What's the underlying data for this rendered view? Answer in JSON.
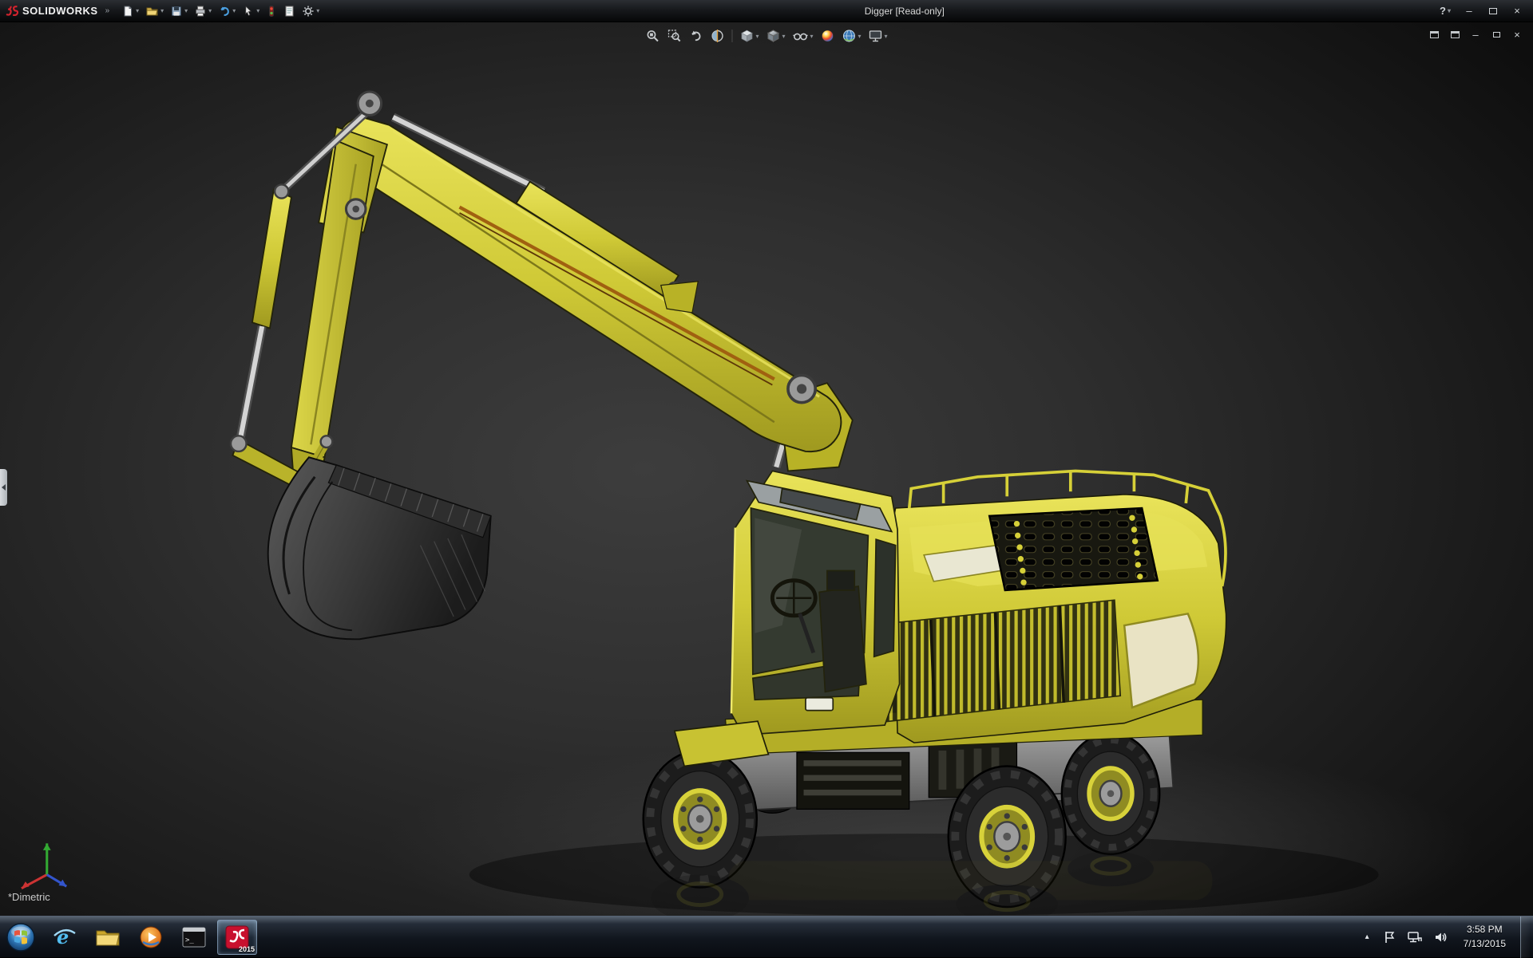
{
  "app": {
    "brand": "SOLIDWORKS",
    "title": "Digger [Read-only]",
    "view_label": "*Dimetric"
  },
  "glyphs": {
    "brand_chevron": "»",
    "dropdown": "▾",
    "help": "?",
    "minimize": "–",
    "close": "×",
    "tray_chevron": "▴"
  },
  "quick_access_toolbar": {
    "items": [
      "new",
      "open",
      "save",
      "print",
      "undo",
      "select",
      "rebuild",
      "file-properties",
      "options"
    ]
  },
  "heads_up_toolbar": {
    "items": [
      "zoom-to-fit",
      "zoom-to-area",
      "previous-view",
      "section-view",
      "view-orientation",
      "display-style",
      "hide-show-items",
      "edit-appearance",
      "apply-scene",
      "view-settings"
    ]
  },
  "document_window_controls": {
    "items": [
      "tile-window",
      "cascade-window",
      "minimize-document",
      "restore-document",
      "close-document"
    ]
  },
  "model": {
    "name": "excavator-3d-model",
    "primary_color": "#cfc936",
    "view": "*Dimetric"
  },
  "taskbar": {
    "buttons": [
      "start",
      "internet-explorer",
      "windows-explorer",
      "media-player",
      "command-prompt",
      "solidworks-2015"
    ],
    "active_button": "solidworks-2015",
    "solidworks_badge": "2015",
    "tray": {
      "time": "3:58 PM",
      "date": "7/13/2015",
      "icons": [
        "hidden-icons-chevron",
        "action-center",
        "network",
        "volume"
      ]
    }
  },
  "icons": {
    "logo-mark": "red 3S solidworks mark",
    "new": "blank document",
    "open": "folder",
    "save": "floppy disk",
    "print": "printer",
    "undo": "curved blue arrow",
    "select": "cursor arrow",
    "rebuild": "traffic light",
    "file-properties": "sheet with lines",
    "options": "gear",
    "zoom-to-fit": "magnifier over box",
    "zoom-to-area": "magnifier with rectangle",
    "previous-view": "back curved arrow",
    "section-view": "sphere cut by plane",
    "view-orientation": "cube",
    "display-style": "shaded cube",
    "hide-show-items": "glasses",
    "edit-appearance": "rainbow ball",
    "apply-scene": "globe",
    "view-settings": "monitor",
    "start": "windows orb",
    "internet-explorer": "blue e with ring",
    "windows-explorer": "yellow folder",
    "media-player": "orange play circle",
    "command-prompt": "black console window",
    "solidworks-2015": "red solidworks app with 2015 badge",
    "action-center": "flag",
    "network": "monitor with plug",
    "volume": "speaker"
  }
}
